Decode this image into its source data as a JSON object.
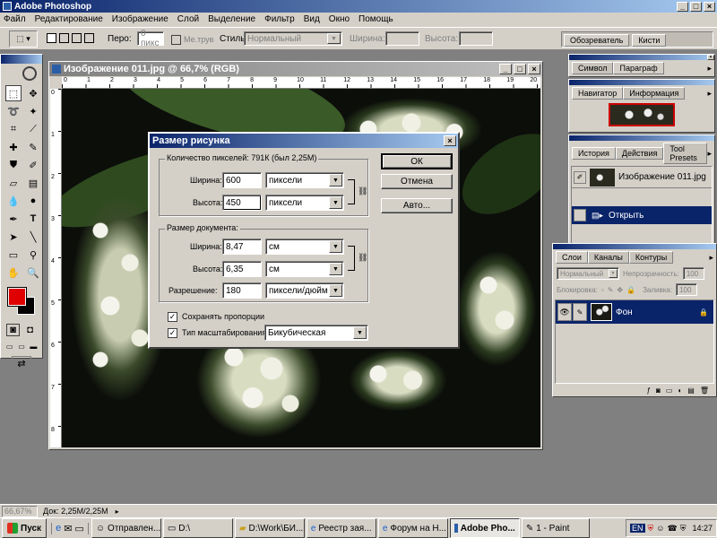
{
  "app": {
    "title": "Adobe Photoshop"
  },
  "menu": [
    "Файл",
    "Редактирование",
    "Изображение",
    "Слой",
    "Выделение",
    "Фильтр",
    "Вид",
    "Окно",
    "Помощь"
  ],
  "options": {
    "feather_label": "Перо:",
    "feather_value": "0 пикс",
    "antialias_label": "Ме.трув",
    "style_label": "Стиль:",
    "style_value": "Нормальный",
    "width_label": "Ширина:",
    "height_label": "Высота:"
  },
  "well": {
    "tabs": [
      "Обозреватель",
      "Кисти"
    ]
  },
  "document": {
    "title": "Изображение 011.jpg @ 66,7% (RGB)",
    "ruler_marks": [
      "0",
      "1",
      "2",
      "3",
      "4",
      "5",
      "6",
      "7",
      "8",
      "9",
      "10",
      "11",
      "12",
      "13",
      "14",
      "15",
      "16",
      "17",
      "18",
      "19",
      "20"
    ],
    "ruler_v": [
      "0",
      "1",
      "2",
      "3",
      "4",
      "5",
      "6",
      "7",
      "8"
    ]
  },
  "dialog": {
    "title": "Размер рисунка",
    "pixel_group": "Количество пикселей: 791К (был 2,25М)",
    "width_label": "Ширина:",
    "width_value": "600",
    "height_label": "Высота:",
    "height_value": "450",
    "px_unit": "пиксели",
    "doc_group": "Размер документа:",
    "doc_width": "8,47",
    "doc_height": "6,35",
    "unit_cm": "см",
    "res_label": "Разрешение:",
    "res_value": "180",
    "res_unit": "пиксели/дюйм",
    "constrain_label": "Сохранять пропорции",
    "resample_label": "Тип масштабирования:",
    "resample_value": "Бикубическая",
    "ok": "ОК",
    "cancel": "Отмена",
    "auto": "Авто..."
  },
  "panels": {
    "char": {
      "tabs": [
        "Символ",
        "Параграф"
      ]
    },
    "nav": {
      "tabs": [
        "Навигатор",
        "Информация"
      ]
    },
    "history": {
      "tabs": [
        "История",
        "Действия",
        "Tool Presets"
      ],
      "snapshot": "Изображение 011.jpg",
      "item": "Открыть"
    },
    "layers": {
      "tabs": [
        "Слои",
        "Каналы",
        "Контуры"
      ],
      "blend": "Нормальный",
      "opacity_label": "Непрозрачность:",
      "opacity_value": "100",
      "lock_label": "Блокировка:",
      "fill_label": "Заливка:",
      "fill_value": "100",
      "layer_name": "Фон"
    }
  },
  "status": {
    "zoom": "66,67%",
    "doc": "Док: 2,25M/2,25M"
  },
  "taskbar": {
    "start": "Пуск",
    "items": [
      "Отправлен...",
      "D:\\",
      "D:\\Work\\БИ...",
      "Реестр зая...",
      "Форум на Н...",
      "Adobe Pho...",
      "1 - Paint"
    ],
    "active_index": 5,
    "lang": "EN",
    "time": "14:27"
  },
  "colors": {
    "foreground": "#e00000",
    "background": "#000000",
    "selection": "#0a246a"
  }
}
